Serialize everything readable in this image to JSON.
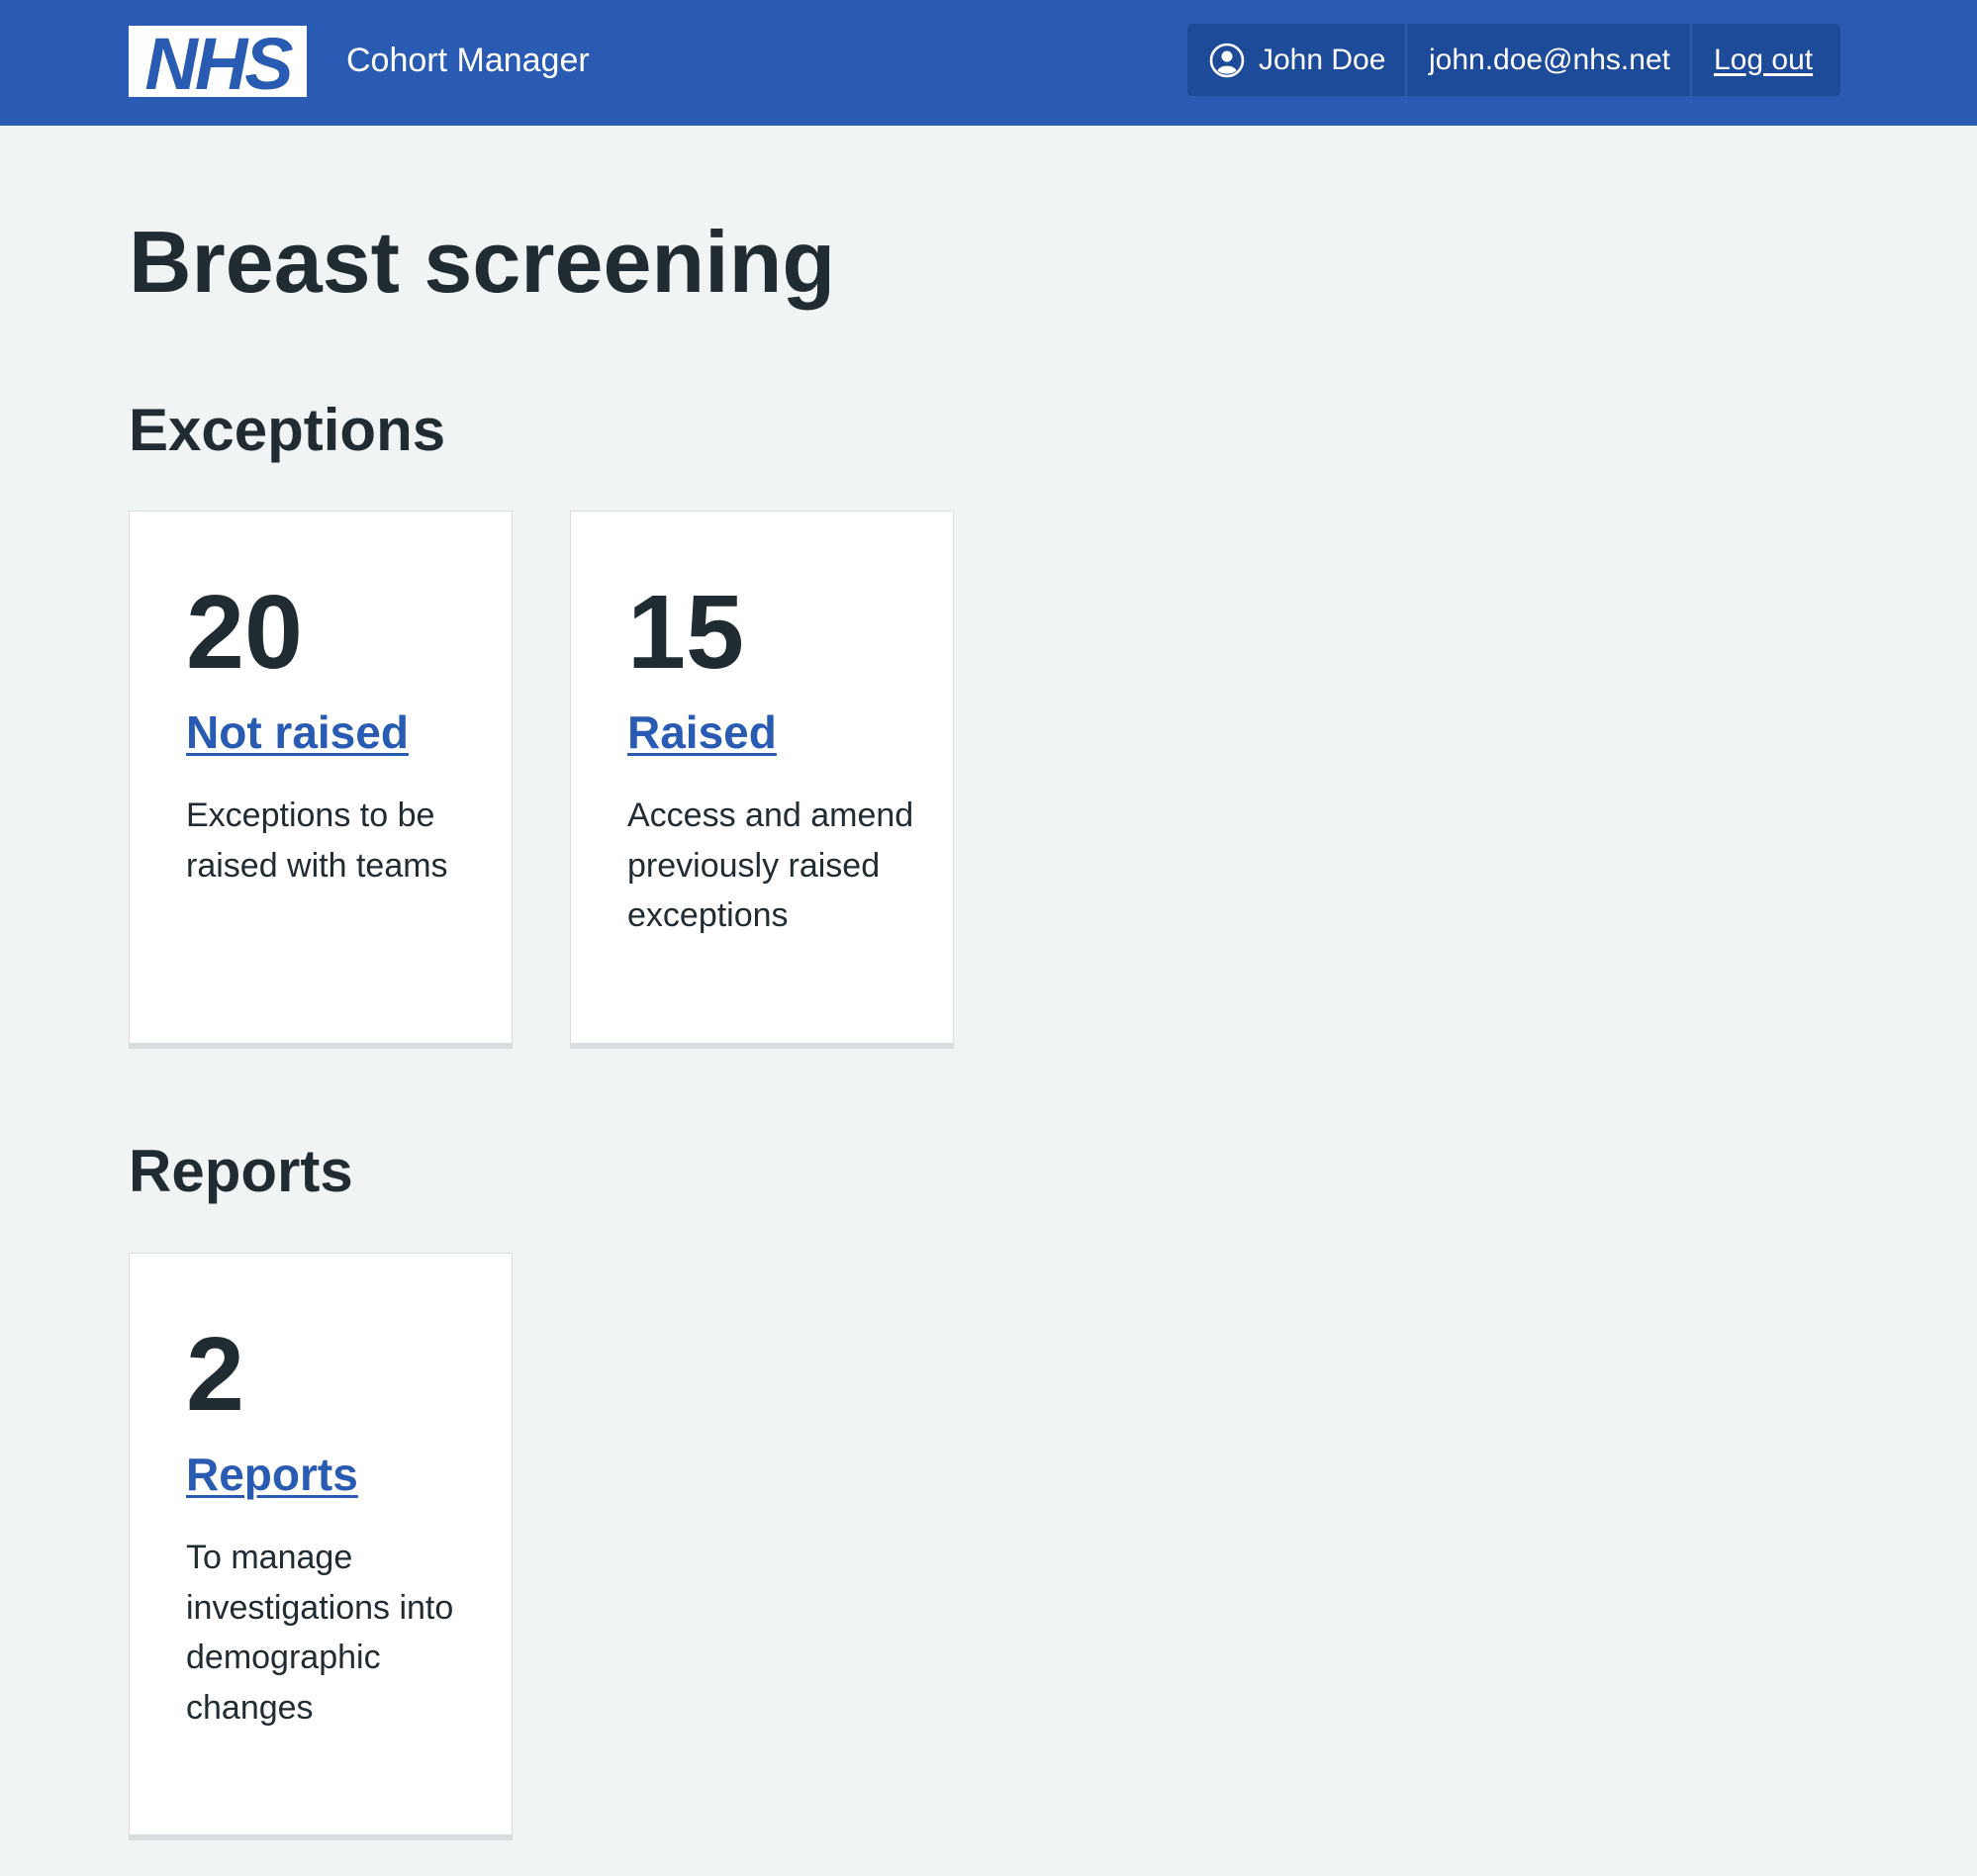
{
  "header": {
    "logo_text": "NHS",
    "service_name": "Cohort Manager",
    "account": {
      "user_name": "John Doe",
      "email": "john.doe@nhs.net",
      "logout_label": "Log out"
    }
  },
  "main": {
    "title": "Breast screening",
    "sections": [
      {
        "title": "Exceptions",
        "cards": [
          {
            "count": "20",
            "link_label": "Not raised",
            "description": "Exceptions to be raised with teams"
          },
          {
            "count": "15",
            "link_label": "Raised",
            "description": "Access and amend previously raised exceptions"
          }
        ]
      },
      {
        "title": "Reports",
        "cards": [
          {
            "count": "2",
            "link_label": "Reports",
            "description": "To manage investigations into demographic changes"
          }
        ]
      }
    ]
  },
  "colors": {
    "header_bg": "#2a5bb2",
    "account_bg": "#1e4a9a",
    "page_bg": "#f0f4f5",
    "link": "#2a5bb2",
    "text": "#212b32"
  },
  "icons": {
    "logo": "nhs-logo",
    "user": "user-circle-icon"
  }
}
